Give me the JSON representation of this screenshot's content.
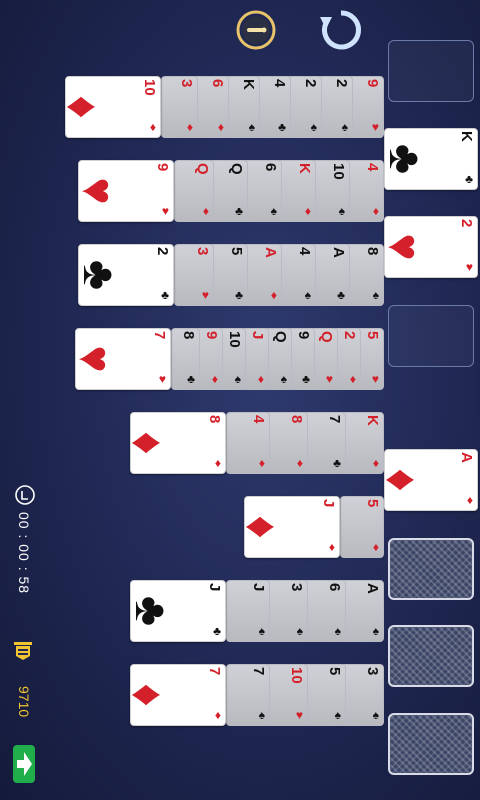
{
  "toolbar": {
    "info_icon": "info-icon",
    "undo_icon": "undo-icon"
  },
  "status": {
    "timer": "00 : 00 : 58",
    "score": "9710",
    "timer_icon": "clock-icon",
    "score_icon": "flag-icon",
    "exit_icon": "exit-icon"
  },
  "foundations": [
    {
      "state": "empty"
    },
    {
      "rank": "K",
      "suit": "♣",
      "color": "black"
    },
    {
      "rank": "2",
      "suit": "♥",
      "color": "red"
    },
    {
      "state": "empty"
    },
    {
      "rank": "A",
      "suit": "♦",
      "color": "red"
    }
  ],
  "stock_count": 3,
  "tableau": [
    {
      "cards": [
        {
          "r": "9",
          "s": "♥",
          "c": "red",
          "up": false
        },
        {
          "r": "2",
          "s": "♠",
          "c": "black",
          "up": false
        },
        {
          "r": "2",
          "s": "♠",
          "c": "black",
          "up": false
        },
        {
          "r": "4",
          "s": "♣",
          "c": "black",
          "up": false
        },
        {
          "r": "K",
          "s": "♠",
          "c": "black",
          "up": false
        },
        {
          "r": "6",
          "s": "♦",
          "c": "red",
          "up": false
        },
        {
          "r": "3",
          "s": "♦",
          "c": "red",
          "up": false
        },
        {
          "r": "10",
          "s": "♦",
          "c": "red",
          "up": true
        }
      ]
    },
    {
      "cards": [
        {
          "r": "4",
          "s": "♦",
          "c": "red",
          "up": false
        },
        {
          "r": "10",
          "s": "♠",
          "c": "black",
          "up": false
        },
        {
          "r": "K",
          "s": "♦",
          "c": "red",
          "up": false
        },
        {
          "r": "6",
          "s": "♠",
          "c": "black",
          "up": false
        },
        {
          "r": "Q",
          "s": "♣",
          "c": "black",
          "up": false
        },
        {
          "r": "Q",
          "s": "♦",
          "c": "red",
          "up": false
        },
        {
          "r": "9",
          "s": "♥",
          "c": "red",
          "up": true
        }
      ]
    },
    {
      "cards": [
        {
          "r": "8",
          "s": "♠",
          "c": "black",
          "up": false
        },
        {
          "r": "A",
          "s": "♣",
          "c": "black",
          "up": false
        },
        {
          "r": "4",
          "s": "♠",
          "c": "black",
          "up": false
        },
        {
          "r": "A",
          "s": "♦",
          "c": "red",
          "up": false
        },
        {
          "r": "5",
          "s": "♣",
          "c": "black",
          "up": false
        },
        {
          "r": "3",
          "s": "♥",
          "c": "red",
          "up": false
        },
        {
          "r": "2",
          "s": "♣",
          "c": "black",
          "up": true
        }
      ]
    },
    {
      "cards": [
        {
          "r": "5",
          "s": "♥",
          "c": "red",
          "up": false
        },
        {
          "r": "2",
          "s": "♦",
          "c": "red",
          "up": false
        },
        {
          "r": "Q",
          "s": "♥",
          "c": "red",
          "up": false
        },
        {
          "r": "9",
          "s": "♣",
          "c": "black",
          "up": false
        },
        {
          "r": "Q",
          "s": "♠",
          "c": "black",
          "up": false
        },
        {
          "r": "J",
          "s": "♦",
          "c": "red",
          "up": false
        },
        {
          "r": "10",
          "s": "♠",
          "c": "black",
          "up": false
        },
        {
          "r": "9",
          "s": "♦",
          "c": "red",
          "up": false
        },
        {
          "r": "8",
          "s": "♣",
          "c": "black",
          "up": false
        },
        {
          "r": "7",
          "s": "♥",
          "c": "red",
          "up": true
        }
      ]
    },
    {
      "cards": [
        {
          "r": "K",
          "s": "♦",
          "c": "red",
          "up": false
        },
        {
          "r": "7",
          "s": "♣",
          "c": "black",
          "up": false
        },
        {
          "r": "8",
          "s": "♦",
          "c": "red",
          "up": false
        },
        {
          "r": "4",
          "s": "♦",
          "c": "red",
          "up": false
        },
        {
          "r": "8",
          "s": "♦",
          "c": "red",
          "up": true
        }
      ]
    },
    {
      "cards": [
        {
          "r": "5",
          "s": "♦",
          "c": "red",
          "up": false
        },
        {
          "r": "J",
          "s": "♦",
          "c": "red",
          "up": true
        }
      ]
    },
    {
      "cards": [
        {
          "r": "A",
          "s": "♠",
          "c": "black",
          "up": false
        },
        {
          "r": "6",
          "s": "♠",
          "c": "black",
          "up": false
        },
        {
          "r": "3",
          "s": "♠",
          "c": "black",
          "up": false
        },
        {
          "r": "J",
          "s": "♠",
          "c": "black",
          "up": false
        },
        {
          "r": "J",
          "s": "♣",
          "c": "black",
          "up": true
        }
      ]
    },
    {
      "cards": [
        {
          "r": "3",
          "s": "♠",
          "c": "black",
          "up": false
        },
        {
          "r": "5",
          "s": "♠",
          "c": "black",
          "up": false
        },
        {
          "r": "10",
          "s": "♥",
          "c": "red",
          "up": false
        },
        {
          "r": "7",
          "s": "♠",
          "c": "black",
          "up": false
        },
        {
          "r": "7",
          "s": "♦",
          "c": "red",
          "up": true
        }
      ]
    }
  ]
}
